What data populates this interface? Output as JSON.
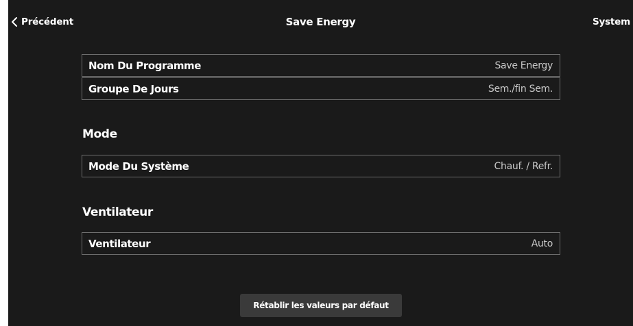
{
  "header": {
    "back_label": "Précédent",
    "title": "Save Energy",
    "right_label": "System"
  },
  "program": {
    "rows": [
      {
        "label": "Nom Du Programme",
        "value": "Save Energy"
      },
      {
        "label": "Groupe De Jours",
        "value": "Sem./fin Sem."
      }
    ]
  },
  "mode": {
    "section_title": "Mode",
    "row": {
      "label": "Mode Du Système",
      "value": "Chauf. / Refr."
    }
  },
  "fan": {
    "section_title": "Ventilateur",
    "row": {
      "label": "Ventilateur",
      "value": "Auto"
    }
  },
  "footer": {
    "reset_label": "Rétablir les valeurs par défaut"
  },
  "icons": {
    "back": "chevron-left-icon"
  },
  "colors": {
    "background": "#1a1a1a",
    "text": "#ffffff",
    "value_text": "#c8c8c8",
    "row_border": "#6e6e6e",
    "button_bg": "#3a3a3a"
  }
}
